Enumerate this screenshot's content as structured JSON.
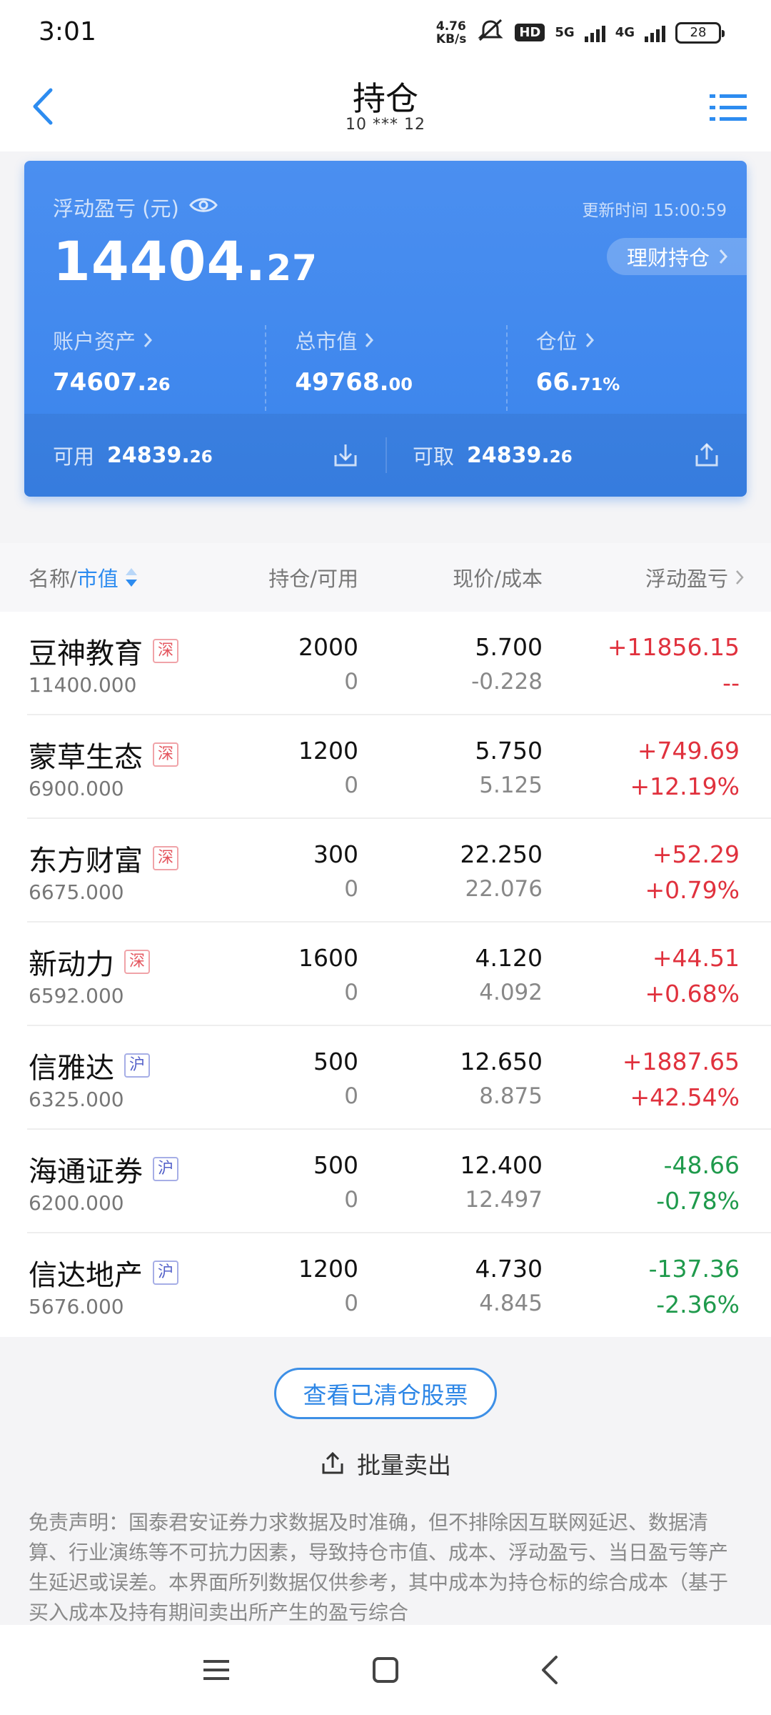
{
  "status_bar": {
    "time": "3:01",
    "speed_value": "4.76",
    "speed_unit": "KB/s",
    "hd_label": "HD",
    "net1": "5G",
    "net2": "4G",
    "battery": "28"
  },
  "header": {
    "title": "持仓",
    "account": "10 *** 12"
  },
  "summary": {
    "float_label": "浮动盈亏 (元)",
    "update_time": "更新时间 15:00:59",
    "float_int": "14404.",
    "float_dec": "27",
    "wealth_button": "理财持仓",
    "assets_label": "账户资产",
    "assets_int": "74607.",
    "assets_dec": "26",
    "market_label": "总市值",
    "market_int": "49768.",
    "market_dec": "00",
    "position_label": "仓位",
    "position_int": "66.",
    "position_dec": "71%",
    "available_label": "可用",
    "available_int": "24839.",
    "available_dec": "26",
    "withdrawable_label": "可取",
    "withdrawable_int": "24839.",
    "withdrawable_dec": "26"
  },
  "list_header": {
    "name_prefix": "名称/",
    "name_sort": "市值",
    "hold": "持仓/可用",
    "price": "现价/成本",
    "pl": "浮动盈亏"
  },
  "holdings": [
    {
      "name": "豆神教育",
      "market": "深",
      "market_value": "11400.000",
      "hold": "2000",
      "available": "0",
      "price": "5.700",
      "cost": "-0.228",
      "pl": "+11856.15",
      "pl_pct": "--",
      "trend": "up"
    },
    {
      "name": "蒙草生态",
      "market": "深",
      "market_value": "6900.000",
      "hold": "1200",
      "available": "0",
      "price": "5.750",
      "cost": "5.125",
      "pl": "+749.69",
      "pl_pct": "+12.19%",
      "trend": "up"
    },
    {
      "name": "东方财富",
      "market": "深",
      "market_value": "6675.000",
      "hold": "300",
      "available": "0",
      "price": "22.250",
      "cost": "22.076",
      "pl": "+52.29",
      "pl_pct": "+0.79%",
      "trend": "up"
    },
    {
      "name": "新动力",
      "market": "深",
      "market_value": "6592.000",
      "hold": "1600",
      "available": "0",
      "price": "4.120",
      "cost": "4.092",
      "pl": "+44.51",
      "pl_pct": "+0.68%",
      "trend": "up"
    },
    {
      "name": "信雅达",
      "market": "沪",
      "market_value": "6325.000",
      "hold": "500",
      "available": "0",
      "price": "12.650",
      "cost": "8.875",
      "pl": "+1887.65",
      "pl_pct": "+42.54%",
      "trend": "up"
    },
    {
      "name": "海通证券",
      "market": "沪",
      "market_value": "6200.000",
      "hold": "500",
      "available": "0",
      "price": "12.400",
      "cost": "12.497",
      "pl": "-48.66",
      "pl_pct": "-0.78%",
      "trend": "down"
    },
    {
      "name": "信达地产",
      "market": "沪",
      "market_value": "5676.000",
      "hold": "1200",
      "available": "0",
      "price": "4.730",
      "cost": "4.845",
      "pl": "-137.36",
      "pl_pct": "-2.36%",
      "trend": "down"
    }
  ],
  "actions": {
    "cleared_stocks": "查看已清仓股票",
    "batch_sell": "批量卖出"
  },
  "disclaimer": "免责声明：国泰君安证券力求数据及时准确，但不排除因互联网延迟、数据清算、行业演练等不可抗力因素，导致持仓市值、成本、浮动盈亏、当日盈亏等产生延迟或误差。本界面所列数据仅供参考，其中成本为持仓标的综合成本（基于买入成本及持有期间卖出所产生的盈亏综合",
  "colors": {
    "accent": "#2d8cf0",
    "card": "#3a84ec",
    "up": "#e0313d",
    "down": "#1f9a4c"
  }
}
